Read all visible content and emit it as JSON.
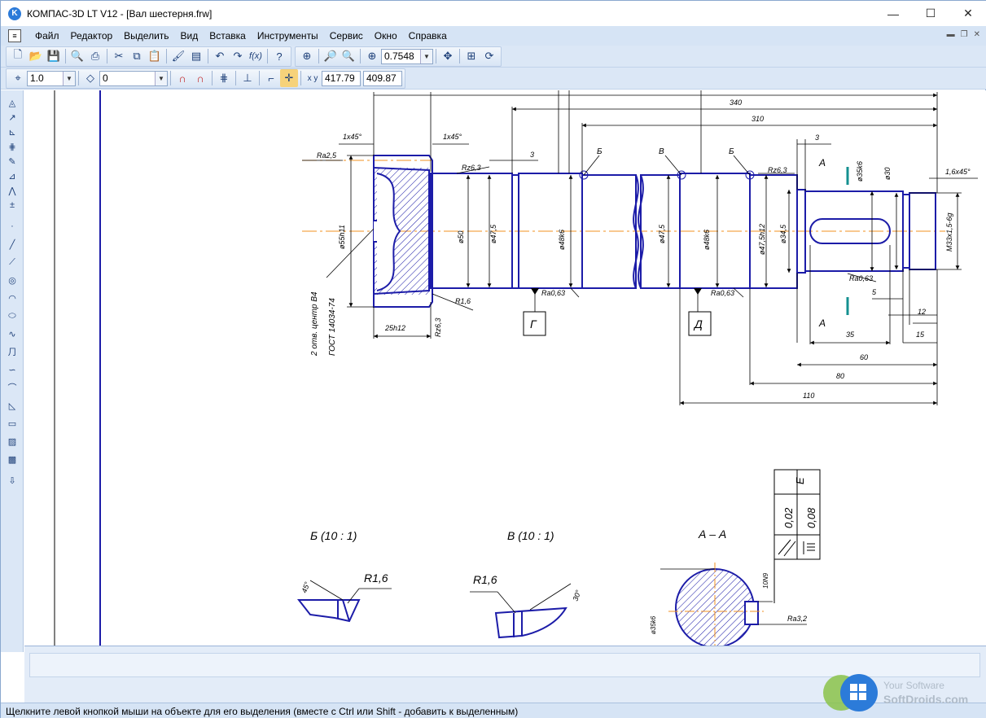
{
  "window": {
    "title": "КОМПАС-3D LT V12 - [Вал шестерня.frw]",
    "minimize_glyph": "—",
    "maximize_glyph": "☐",
    "close_glyph": "✕"
  },
  "menu": {
    "items": [
      "Файл",
      "Редактор",
      "Выделить",
      "Вид",
      "Вставка",
      "Инструменты",
      "Сервис",
      "Окно",
      "Справка"
    ]
  },
  "toolbar1": {
    "zoom_value": "0.7548"
  },
  "toolbar2": {
    "step_value": "1.0",
    "layer_value": "0",
    "coord_x": "417.79",
    "coord_y": "409.87"
  },
  "drawing": {
    "dims": {
      "d340": "340",
      "d310": "310",
      "d3a": "3",
      "d3b": "3",
      "d1x45a": "1x45°",
      "d1x45b": "1x45°",
      "d16x45": "1,6x45°",
      "d35": "35",
      "d60": "60",
      "d80": "80",
      "d110": "110",
      "d5": "5",
      "d12": "12",
      "d15": "15",
      "d25": "25h12",
      "phi55": "ø55h11",
      "phi50": "ø50",
      "phi475a": "ø47,5",
      "phi475b": "ø47,5",
      "phi48a": "ø48k6",
      "phi48b": "ø48k6",
      "phi475c": "ø47,5h12",
      "phi345": "ø34,5",
      "phi35": "ø35k6",
      "phi30": "ø30",
      "m33": "M33x1,5-6g"
    },
    "rough": {
      "ra25": "Ra2,5",
      "rz63a": "Rz6,3",
      "rz63b": "Rz6,3",
      "ra063a": "Ra0,63",
      "ra063b": "Ra0,63",
      "ra063c": "Ra0,63",
      "ra32": "Ra3,2",
      "r16": "R1,6"
    },
    "labels": {
      "b": "Б",
      "v": "В",
      "a": "А",
      "g_box": "Г",
      "d_box": "Д",
      "center_note_1": "2 отв. центр В4",
      "center_note_2": "ГОСТ 14034-74",
      "section_b": "Б (10 : 1)",
      "section_v": "В (10 : 1)",
      "section_aa": "А – А",
      "r16_b": "R1,6",
      "r16_v": "R1,6",
      "angle_b": "45°",
      "angle_v": "30°",
      "tol_val1": "0,02",
      "tol_val2": "0,08",
      "tol_base": "Е",
      "aa_dim1": "ø35k6",
      "aa_dim2": "10N9"
    }
  },
  "status": {
    "text": "Щелкните левой кнопкой мыши на объекте для его выделения (вместе с Ctrl или Shift - добавить к выделенным)"
  },
  "watermark": {
    "line1": "Your Software",
    "line2": "SoftDroids.com"
  },
  "colors": {
    "outline": "#1c1ca8",
    "axis": "#f09020",
    "dim": "#000000",
    "accent": "#2c7bd9"
  }
}
